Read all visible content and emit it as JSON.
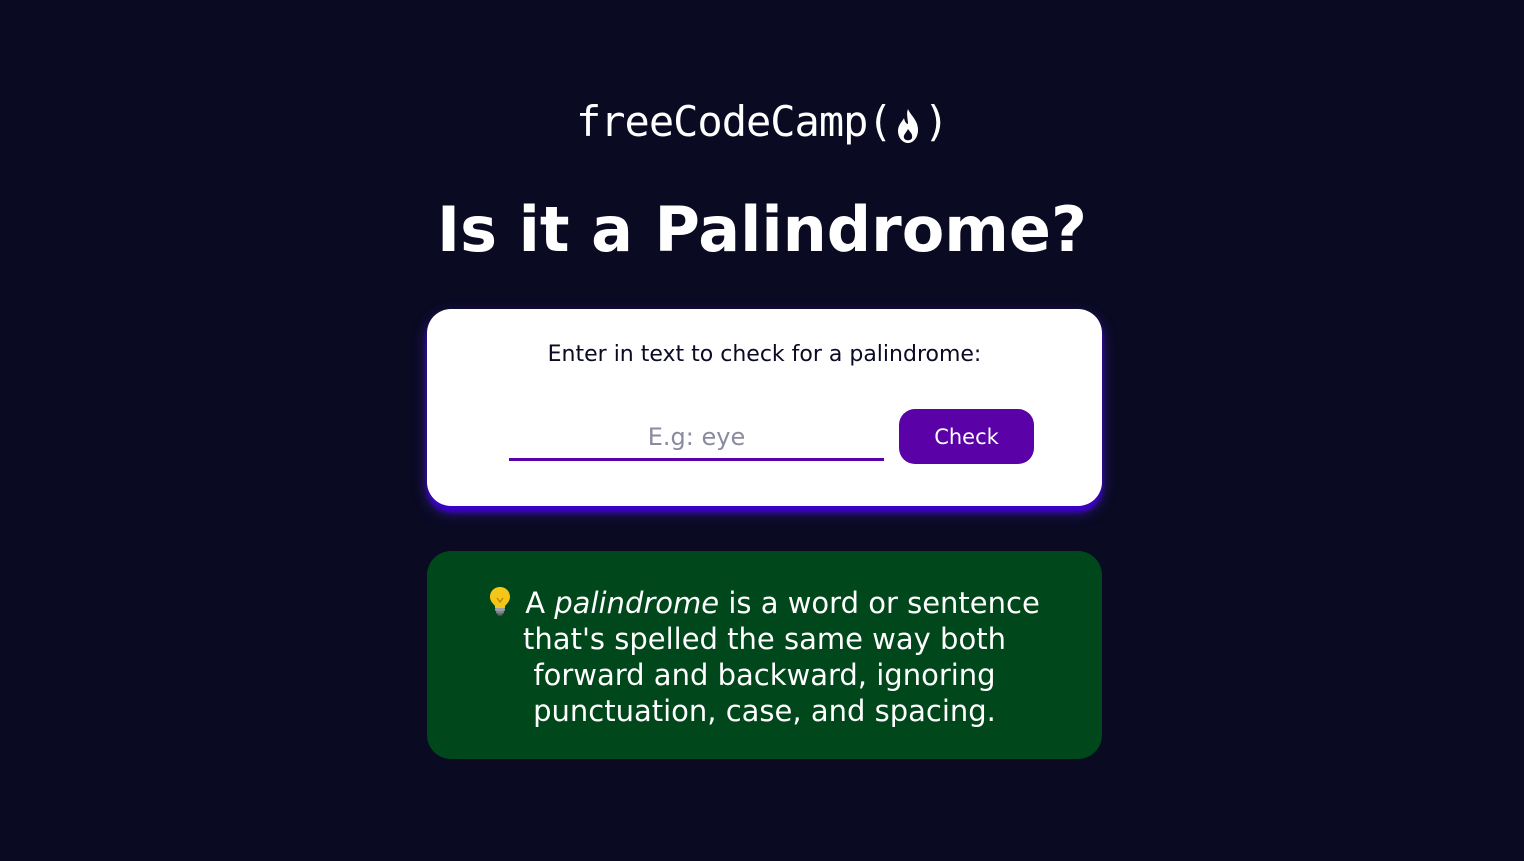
{
  "logo": {
    "text": "freeCodeCamp",
    "open_paren": "(",
    "close_paren": ")",
    "icon": "flame-icon"
  },
  "title": "Is it a Palindrome?",
  "form": {
    "label": "Enter in text to check for a palindrome:",
    "input_value": "",
    "input_placeholder": "E.g: eye",
    "button_label": "Check"
  },
  "info": {
    "icon": "lightbulb-icon",
    "prefix": "A",
    "emphasis": "palindrome",
    "suffix": "is a word or sentence that's spelled the same way both forward and backward, ignoring punctuation, case, and spacing."
  },
  "colors": {
    "background": "#0a0a23",
    "card": "#ffffff",
    "accent": "#5a01a7",
    "card_shadow": "#3b00c9",
    "info_background": "#00471b"
  }
}
